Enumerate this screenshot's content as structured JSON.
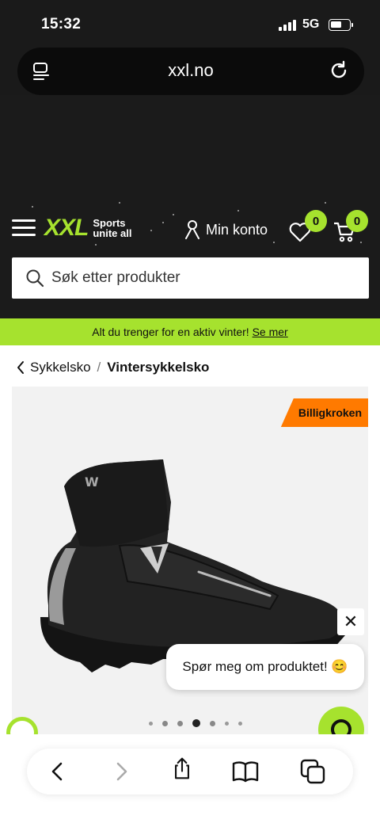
{
  "status": {
    "time": "15:32",
    "network": "5G"
  },
  "browser": {
    "url": "xxl.no"
  },
  "header": {
    "logo_mark": "XXL",
    "logo_tagline_1": "Sports",
    "logo_tagline_2": "unite all",
    "account_label": "Min konto",
    "wishlist_count": "0",
    "cart_count": "0",
    "search_placeholder": "Søk etter produkter"
  },
  "promo": {
    "text": "Alt du trenger for en aktiv vinter!",
    "link": "Se mer"
  },
  "breadcrumb": {
    "parent": "Sykkelsko",
    "separator": "/",
    "current": "Vintersykkelsko"
  },
  "product": {
    "tag": "Billigkroken"
  },
  "chat": {
    "prompt": "Spør meg om produktet! 😊",
    "close": "✕"
  },
  "carousel": {
    "total": 7,
    "active_index": 3
  },
  "colors": {
    "accent": "#a6e22e",
    "tag": "#ff7a00",
    "header_bg": "#1b1b1b"
  },
  "toolbar": {
    "icons": [
      "back-icon",
      "forward-icon",
      "share-icon",
      "bookmarks-icon",
      "tabs-icon"
    ]
  }
}
